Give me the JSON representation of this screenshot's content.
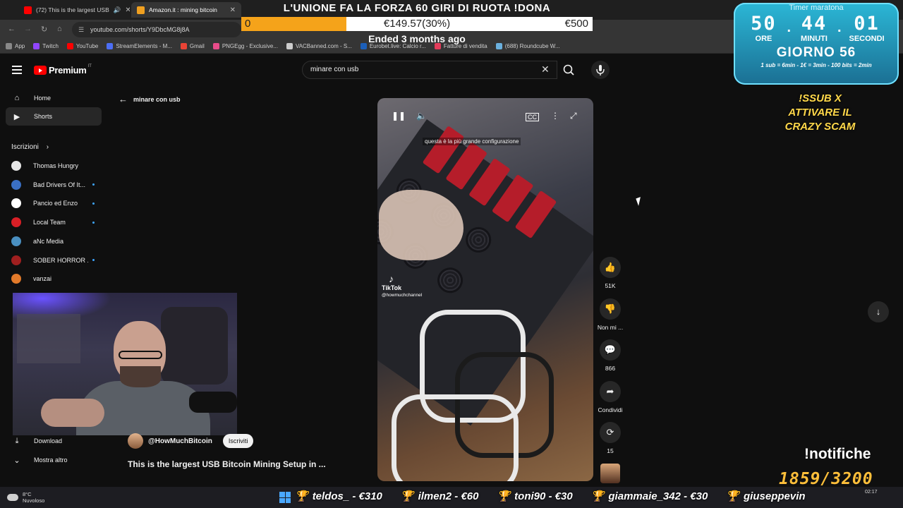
{
  "browser": {
    "tabs": [
      {
        "title": "(72) This is the largest USB",
        "fav": "#ff0000",
        "active": false
      },
      {
        "title": "Amazon.it : mining bitcoin",
        "fav": "#f0a020",
        "active": true
      }
    ],
    "url": "youtube.com/shorts/Y9DbcMG8j8A",
    "bookmarks": [
      {
        "label": "App",
        "color": "#888888"
      },
      {
        "label": "Twitch",
        "color": "#9146ff"
      },
      {
        "label": "YouTube",
        "color": "#ff0000"
      },
      {
        "label": "StreamElements - M...",
        "color": "#4c6ef5"
      },
      {
        "label": "Gmail",
        "color": "#ea4335"
      },
      {
        "label": "PNGEgg - Exclusive...",
        "color": "#e84c8a"
      },
      {
        "label": "VACBanned.com - S...",
        "color": "#cccccc"
      },
      {
        "label": "Eurobet.live: Calcio r...",
        "color": "#1c5fb8"
      },
      {
        "label": "Fatture di vendita",
        "color": "#e23c5a"
      },
      {
        "label": "(688) Roundcube W...",
        "color": "#6ab0de"
      }
    ]
  },
  "donation": {
    "title": "L'UNIONE FA LA FORZA 60 GIRI DI RUOTA !DONA",
    "start": "0",
    "current": "€149.57(30%)",
    "goal": "€500",
    "progress_fraction": 0.3,
    "status": "Ended 3 months ago"
  },
  "youtube": {
    "logo_text": "Premium",
    "logo_region": "IT",
    "search_value": "minare con usb",
    "nav": [
      {
        "label": "Home",
        "icon": "home-icon",
        "glyph": "⌂"
      },
      {
        "label": "Shorts",
        "icon": "shorts-icon",
        "glyph": "▶"
      }
    ],
    "subscriptions_title": "Iscrizioni",
    "subscriptions": [
      {
        "name": "Thomas Hungry",
        "color": "#e6e6e6",
        "new": false
      },
      {
        "name": "Bad Drivers Of It...",
        "color": "#3a6fc4",
        "new": true
      },
      {
        "name": "Pancio ed Enzo",
        "color": "#ffffff",
        "new": true
      },
      {
        "name": "Local Team",
        "color": "#d81f26",
        "new": true
      },
      {
        "name": "aNc Media",
        "color": "#4a8fc0",
        "new": false
      },
      {
        "name": "SOBER HORROR ...",
        "color": "#a01f1f",
        "new": true
      },
      {
        "name": "vanzai",
        "color": "#e27a2a",
        "new": false
      }
    ],
    "bottom_nav": [
      {
        "label": "Download",
        "glyph": "⤓"
      },
      {
        "label": "Mostra altro",
        "glyph": "⌄"
      }
    ],
    "back_label": "minare con usb",
    "channel": "@HowMuchBitcoin",
    "subscribe_label": "Iscriviti",
    "short_title": "This is the largest USB Bitcoin Mining Setup in ...",
    "video_caption": "questa è la più grande configurazione",
    "tiktok_label": "TikTok",
    "tiktok_handle": "@howmuchchannel",
    "actions": [
      {
        "name": "like",
        "glyph": "👍",
        "label": "51K"
      },
      {
        "name": "dislike",
        "glyph": "👎",
        "label": "Non mi ..."
      },
      {
        "name": "comments",
        "glyph": "💬",
        "label": "866"
      },
      {
        "name": "share",
        "glyph": "➦",
        "label": "Condividi"
      },
      {
        "name": "remix",
        "glyph": "⟳",
        "label": "15"
      }
    ]
  },
  "timer": {
    "title": "Timer maratona",
    "hours": "50",
    "minutes": "44",
    "seconds": "01",
    "hours_label": "ORE",
    "minutes_label": "MINUTI",
    "seconds_label": "SECONDI",
    "day": "GIORNO 56",
    "rates": "1 sub = 6min - 1€ = 3min - 100 bits = 2min"
  },
  "overlay": {
    "crazy_line1": "!SSUB X",
    "crazy_line2": "ATTIVARE IL",
    "crazy_line3": "CRAZY SCAM",
    "notifiche": "!notifiche",
    "sub_goal": "1859/3200"
  },
  "taskbar": {
    "temp": "8°C",
    "condition": "Nuvoloso",
    "clock": "02:17",
    "ticker": [
      "teldos_ - €310",
      "ilmen2 - €60",
      "toni90 - €30",
      "giammaie_342 - €30",
      "giuseppevin"
    ]
  }
}
